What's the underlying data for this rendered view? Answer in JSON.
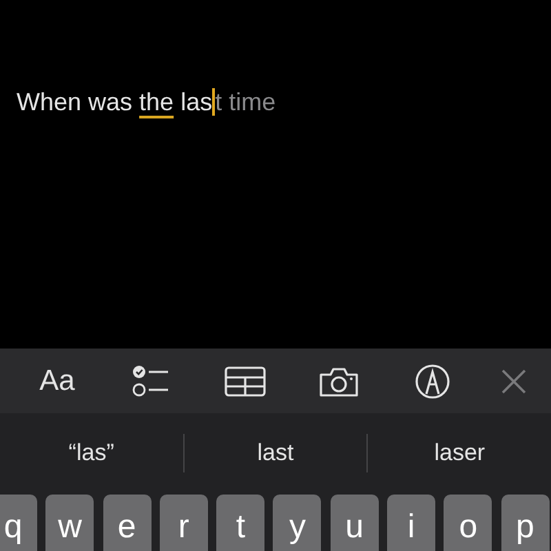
{
  "note": {
    "before": "When was ",
    "flagged": "the",
    "typed": " las",
    "completion": "t time"
  },
  "toolbar": [
    {
      "kind": "format",
      "label": "Aa"
    },
    {
      "kind": "checklist"
    },
    {
      "kind": "table"
    },
    {
      "kind": "camera"
    },
    {
      "kind": "markup"
    },
    {
      "kind": "close"
    }
  ],
  "suggestions": [
    "“las”",
    "last",
    "laser"
  ],
  "keys": [
    "q",
    "w",
    "e",
    "r",
    "t",
    "y",
    "u",
    "i",
    "o",
    "p"
  ]
}
